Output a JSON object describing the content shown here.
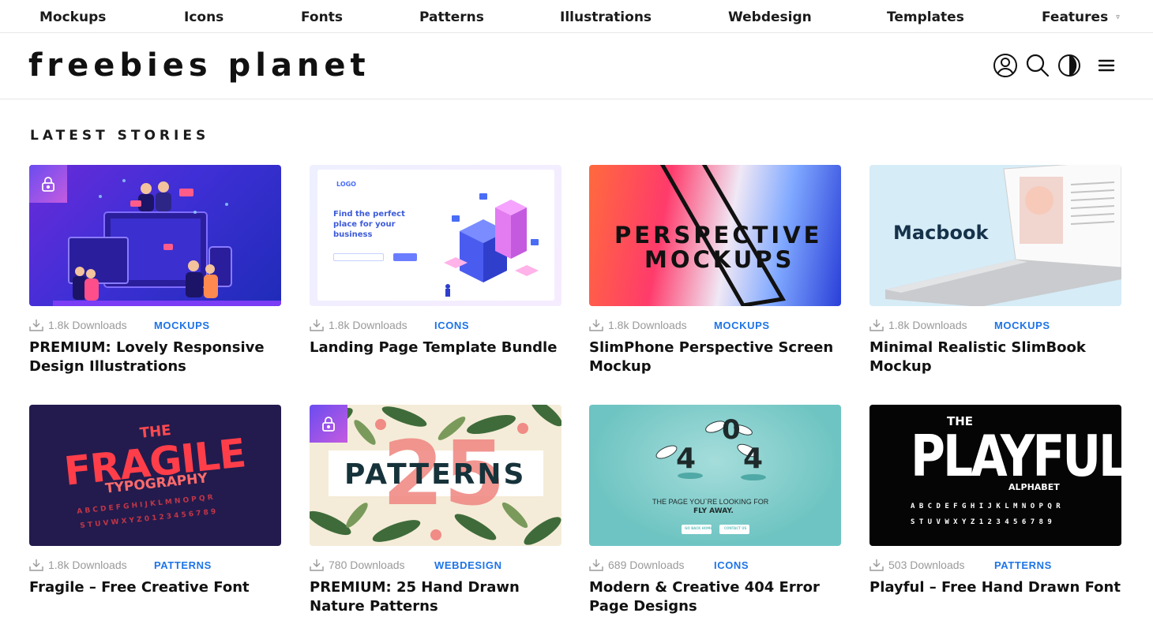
{
  "nav": {
    "items": [
      "Mockups",
      "Icons",
      "Fonts",
      "Patterns",
      "Illustrations",
      "Webdesign",
      "Templates",
      "Features"
    ],
    "features_caret": "▿"
  },
  "header": {
    "logo": "freebies planet",
    "icons": [
      "user-icon",
      "search-icon",
      "dark-mode-icon",
      "menu-icon"
    ]
  },
  "section": {
    "title": "LATEST STORIES"
  },
  "cards": [
    {
      "downloads": "1.8k Downloads",
      "category": "MOCKUPS",
      "title": "PREMIUM: Lovely Responsive Design Illustrations",
      "premium": true
    },
    {
      "downloads": "1.8k Downloads",
      "category": "ICONS",
      "title": "Landing Page Template Bundle",
      "premium": false,
      "thumb_text": {
        "logo": "LOGO",
        "heading": "Find the perfect place for your business"
      }
    },
    {
      "downloads": "1.8k Downloads",
      "category": "MOCKUPS",
      "title": "SlimPhone Perspective Screen Mockup",
      "premium": false,
      "thumb_text": {
        "line1": "PERSPECTIVE",
        "line2": "MOCKUPS"
      }
    },
    {
      "downloads": "1.8k Downloads",
      "category": "MOCKUPS",
      "title": "Minimal Realistic SlimBook Mockup",
      "premium": false,
      "thumb_text": {
        "brand": "Macbook"
      }
    },
    {
      "downloads": "1.8k Downloads",
      "category": "PATTERNS",
      "title": "Fragile – Free Creative Font",
      "premium": false,
      "thumb_text": {
        "the": "THE",
        "word": "FRAGILE",
        "sub": "TYPOGRAPHY",
        "alpha1": "A B C D E F G H I J K L M N O P Q R",
        "alpha2": "S T U V W X Y Z 0 1 2 3 4 5 6 7 8 9"
      }
    },
    {
      "downloads": "780 Downloads",
      "category": "WEBDESIGN",
      "title": "PREMIUM: 25 Hand Drawn Nature Patterns",
      "premium": true,
      "thumb_text": {
        "number": "25",
        "word": "PATTERNS"
      }
    },
    {
      "downloads": "689 Downloads",
      "category": "ICONS",
      "title": "Modern & Creative 404 Error Page Designs",
      "premium": false,
      "thumb_text": {
        "d1": "4",
        "d2": "0",
        "d3": "4",
        "line1": "THE PAGE YOU`RE LOOKING FOR",
        "line2": "FLY AWAY.",
        "btn1": "GO BACK HOME",
        "btn2": "CONTACT US"
      }
    },
    {
      "downloads": "503 Downloads",
      "category": "PATTERNS",
      "title": "Playful – Free Hand Drawn Font",
      "premium": false,
      "thumb_text": {
        "the": "THE",
        "word": "PLAYFUL",
        "sub": "ALPHABET",
        "alpha1": "A B C D E F G H I J K L M N O P Q R",
        "alpha2": "S T U V W X Y Z 1 2 3 4 5 6 7 8 9"
      }
    }
  ],
  "colors": {
    "accent": "#1e74e6",
    "muted": "#9a9a9a",
    "border": "#e6e6e6"
  }
}
